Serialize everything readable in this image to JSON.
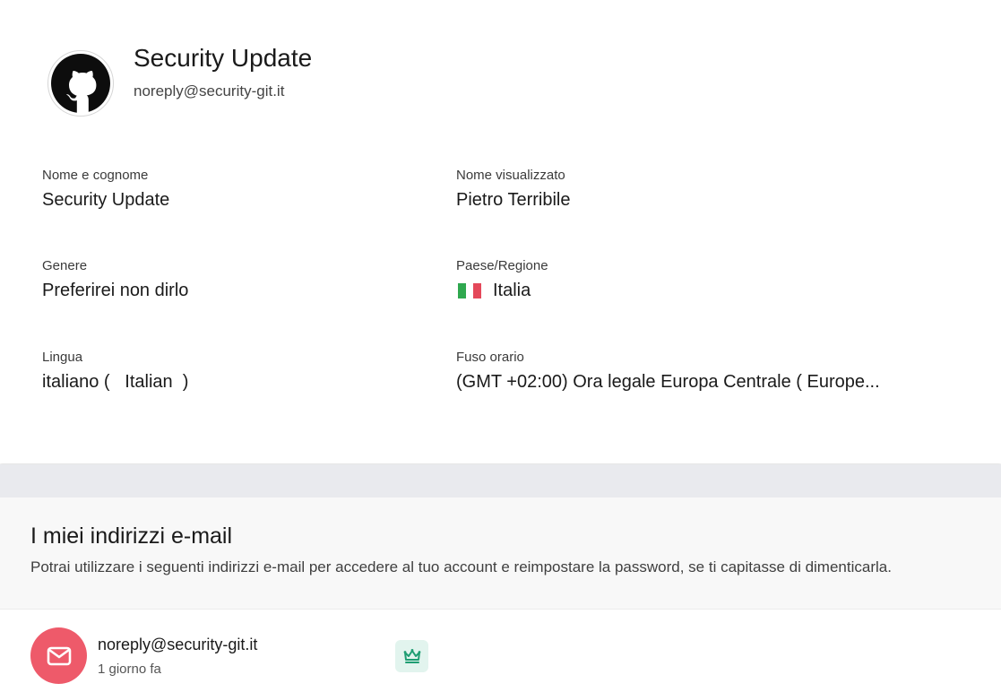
{
  "profile": {
    "display_title": "Security Update",
    "email": "noreply@security-git.it",
    "avatar_icon": "github-icon"
  },
  "fields": {
    "full_name": {
      "label": "Nome e cognome",
      "value": "Security Update"
    },
    "display_name": {
      "label": "Nome visualizzato",
      "value": "Pietro Terribile"
    },
    "gender": {
      "label": "Genere",
      "value": "Preferirei non dirlo"
    },
    "country": {
      "label": "Paese/Regione",
      "value": "Italia",
      "flag_icon": "italy-flag-icon",
      "flag_colors": [
        "#2fa84f",
        "#ffffff",
        "#e4485a"
      ]
    },
    "language": {
      "label": "Lingua",
      "value": "italiano (   Italian  )"
    },
    "timezone": {
      "label": "Fuso orario",
      "value": "(GMT +02:00) Ora legale Europa Centrale ( Europe..."
    }
  },
  "email_section": {
    "title": "I miei indirizzi e-mail",
    "description": "Potrai utilizzare i seguenti indirizzi e-mail per accedere al tuo account e reimpostare la password, se ti capitasse di dimenticarla."
  },
  "email_list": [
    {
      "address": "noreply@security-git.it",
      "added": "1 giorno fa",
      "icon": "mail-icon",
      "badge_icon": "crown-icon"
    }
  ],
  "colors": {
    "mail_accent": "#ee5a6a",
    "primary_badge_bg": "#e2f4ee",
    "primary_badge_fg": "#1f9e73",
    "section_band": "#e9eaee"
  }
}
